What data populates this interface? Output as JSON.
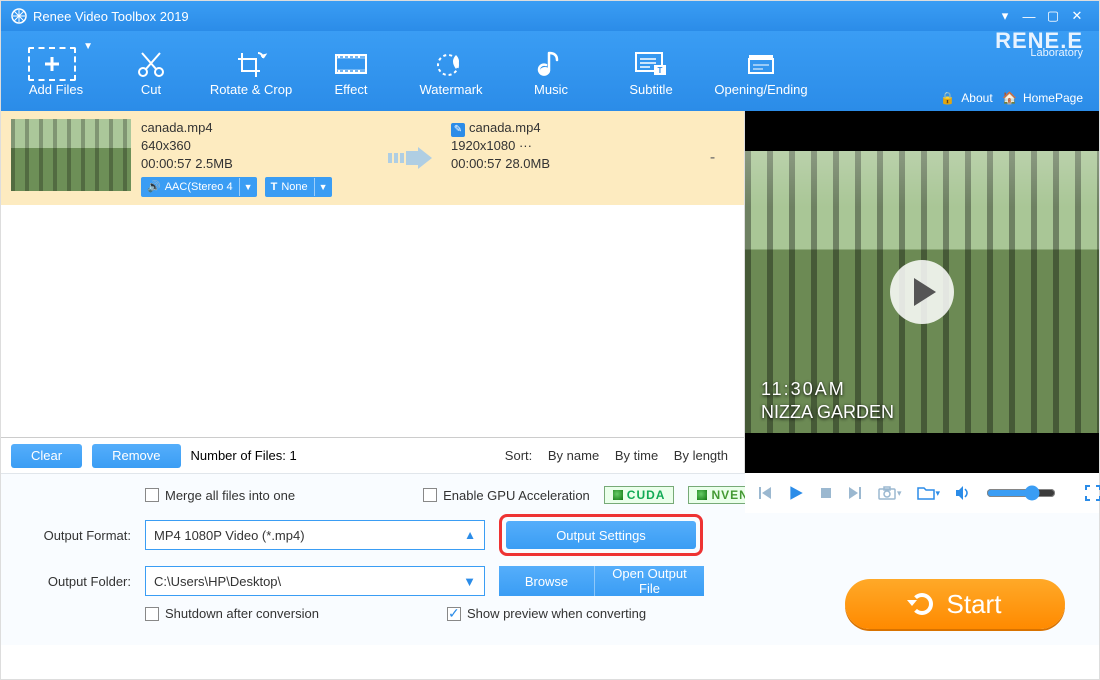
{
  "title": "Renee Video Toolbox 2019",
  "brand": {
    "name": "RENE.E",
    "sub": "Laboratory"
  },
  "header_links": {
    "about": "About",
    "homepage": "HomePage"
  },
  "toolbar": [
    {
      "id": "add",
      "label": "Add Files"
    },
    {
      "id": "cut",
      "label": "Cut"
    },
    {
      "id": "rotate",
      "label": "Rotate & Crop"
    },
    {
      "id": "effect",
      "label": "Effect"
    },
    {
      "id": "water",
      "label": "Watermark"
    },
    {
      "id": "music",
      "label": "Music"
    },
    {
      "id": "sub",
      "label": "Subtitle"
    },
    {
      "id": "opend",
      "label": "Opening/Ending"
    }
  ],
  "file": {
    "src_name": "canada.mp4",
    "src_res": "640x360",
    "src_dur_size": "00:00:57  2.5MB",
    "dst_name": "canada.mp4",
    "dst_res": "1920x1080   ···",
    "dst_dur_size": "00:00:57  28.0MB",
    "audio_pill": "AAC(Stereo 4",
    "sub_pill": "None",
    "dash": "-"
  },
  "list_footer": {
    "clear": "Clear",
    "remove": "Remove",
    "count_label": "Number of Files:  1",
    "sort_label": "Sort:",
    "sort_byname": "By name",
    "sort_bytime": "By time",
    "sort_bylength": "By length"
  },
  "preview_overlay": {
    "time": "11:30AM",
    "place": "NIZZA GARDEN"
  },
  "bottom": {
    "merge": "Merge all files into one",
    "gpu": "Enable GPU Acceleration",
    "cuda": "CUDA",
    "nvenc": "NVENC",
    "format_label": "Output Format:",
    "format_value": "MP4 1080P Video (*.mp4)",
    "output_settings": "Output Settings",
    "folder_label": "Output Folder:",
    "folder_value": "C:\\Users\\HP\\Desktop\\",
    "browse": "Browse",
    "open_output": "Open Output File",
    "shutdown": "Shutdown after conversion",
    "show_preview": "Show preview when converting",
    "start": "Start"
  }
}
